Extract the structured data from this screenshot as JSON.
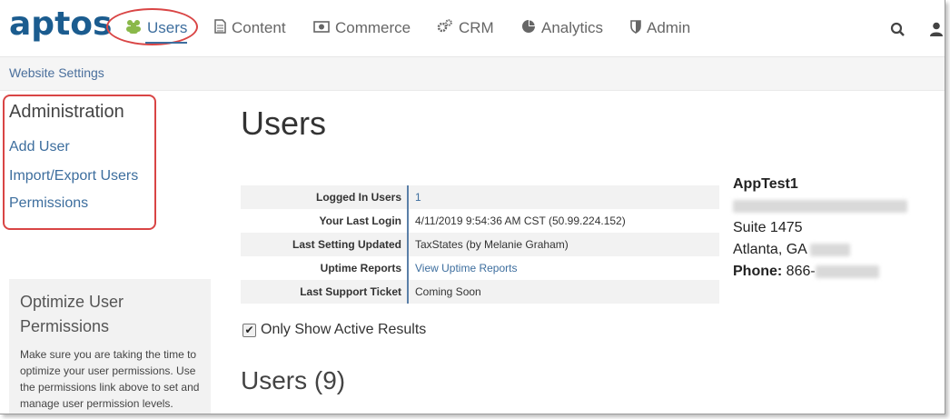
{
  "brand": {
    "logo_text": "aptos",
    "brand_color": "#1b5c8f",
    "accent_color": "#d94545"
  },
  "nav": {
    "items": [
      {
        "label": "Users",
        "icon": "users-icon",
        "active": true
      },
      {
        "label": "Content",
        "icon": "document-icon"
      },
      {
        "label": "Commerce",
        "icon": "money-icon"
      },
      {
        "label": "CRM",
        "icon": "gears-icon"
      },
      {
        "label": "Analytics",
        "icon": "pie-chart-icon"
      },
      {
        "label": "Admin",
        "icon": "shield-icon"
      }
    ],
    "right_icons": [
      "search-icon",
      "user-icon"
    ]
  },
  "breadcrumb": {
    "label": "Website Settings"
  },
  "sidebar": {
    "title": "Administration",
    "links": [
      "Add User",
      "Import/Export Users",
      "Permissions"
    ],
    "tip": {
      "title": "Optimize User Permissions",
      "body": "Make sure you are taking the time to optimize your user permissions. Use the permissions link above to set and manage user permission levels."
    }
  },
  "main": {
    "title": "Users",
    "info": [
      {
        "label": "Logged In Users",
        "value": "1",
        "is_link": true
      },
      {
        "label": "Your Last Login",
        "value": "4/11/2019 9:54:36 AM CST (50.99.224.152)"
      },
      {
        "label": "Last Setting Updated",
        "value": "TaxStates (by Melanie Graham)"
      },
      {
        "label": "Uptime Reports",
        "value": "View Uptime Reports",
        "is_link": true
      },
      {
        "label": "Last Support Ticket",
        "value": "Coming Soon"
      }
    ],
    "address": {
      "name": "AppTest1",
      "suite": "Suite 1475",
      "city": "Atlanta, GA",
      "phone_label": "Phone:",
      "phone_prefix": "866-"
    },
    "active_checkbox": {
      "label": "Only Show Active Results",
      "checked": true
    },
    "users_heading": "Users (9)"
  }
}
